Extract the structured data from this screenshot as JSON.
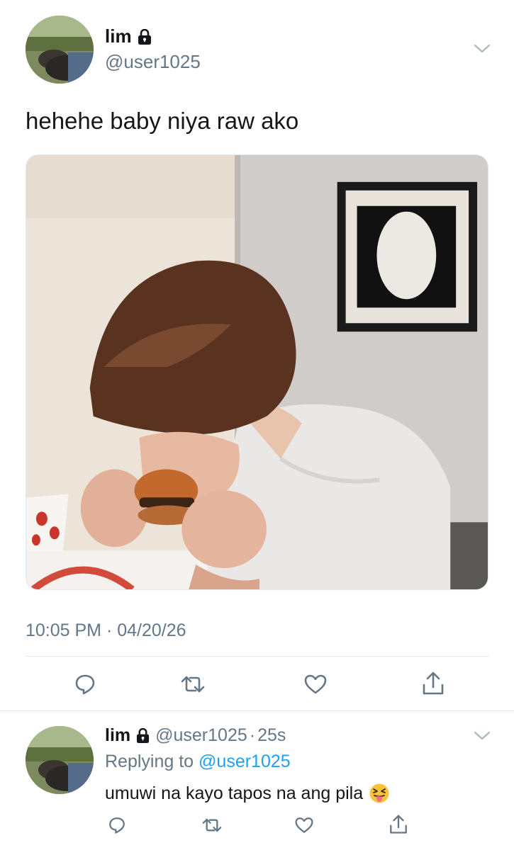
{
  "tweet": {
    "display_name": "lim",
    "handle": "@user1025",
    "text": "hehehe baby niya raw ako",
    "timestamp": "10:05 PM · 04/20/26",
    "media_description_icon": "photo-person-eating-burger",
    "actions": {
      "reply_icon": "reply-icon",
      "retweet_icon": "retweet-icon",
      "like_icon": "heart-icon",
      "share_icon": "share-icon"
    }
  },
  "reply": {
    "display_name": "lim",
    "handle": "@user1025",
    "separator": "·",
    "time": "25s",
    "replying_prefix": "Replying to",
    "replying_to": "@user1025",
    "text": "umuwi na kayo tapos na ang pila",
    "emoji_icon": "squinting-face-with-tongue-icon"
  },
  "colors": {
    "text_primary": "#14171a",
    "text_secondary": "#657786",
    "link": "#1da1f2",
    "divider": "#e1e8ed"
  }
}
